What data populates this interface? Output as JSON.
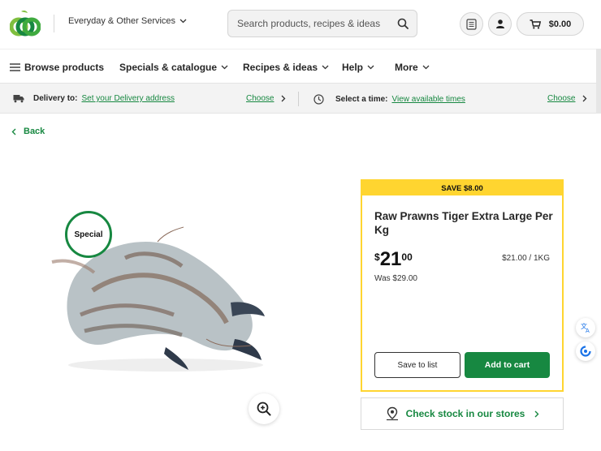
{
  "header": {
    "services_label": "Everyday & Other Services",
    "search_placeholder": "Search products, recipes & ideas",
    "cart_total": "$0.00"
  },
  "nav": {
    "items": [
      {
        "label": "Browse products"
      },
      {
        "label": "Specials & catalogue"
      },
      {
        "label": "Recipes & ideas"
      },
      {
        "label": "Help"
      },
      {
        "label": "More"
      }
    ]
  },
  "delivery": {
    "delivery_label": "Delivery to:",
    "delivery_link": "Set your Delivery address",
    "choose_label": "Choose",
    "time_label": "Select a time:",
    "time_link": "View available times",
    "choose_label_2": "Choose"
  },
  "back_label": "Back",
  "product": {
    "badge": "Special",
    "save_banner": "SAVE $8.00",
    "title": "Raw Prawns Tiger Extra Large Per Kg",
    "price_currency": "$",
    "price_dollars": "21",
    "price_cents": "00",
    "unit_price": "$21.00 / 1KG",
    "was_price": "Was $29.00",
    "save_to_list": "Save to list",
    "add_to_cart": "Add to cart"
  },
  "stock_label": "Check stock in our stores",
  "colors": {
    "brand_green": "#178841",
    "save_yellow": "#ffd530"
  },
  "icons": [
    "woolworths-logo",
    "chevron-down-icon",
    "search-icon",
    "list-icon",
    "user-icon",
    "cart-icon",
    "menu-icon",
    "truck-icon",
    "clock-icon",
    "chevron-right-icon",
    "chevron-left-icon",
    "zoom-in-icon",
    "location-pin-icon",
    "translate-icon",
    "assistant-icon"
  ]
}
